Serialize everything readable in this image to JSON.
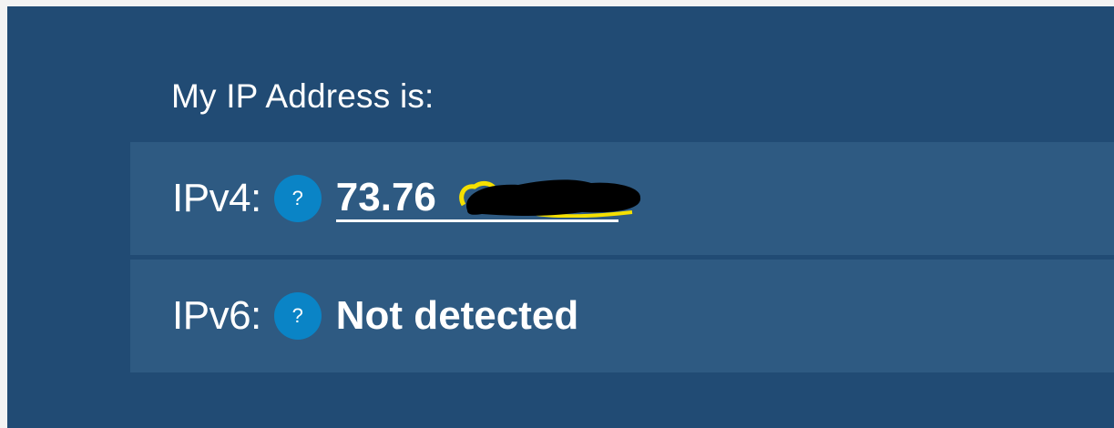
{
  "heading": "My IP Address is:",
  "ipv4": {
    "label": "IPv4:",
    "help_icon_text": "?",
    "value": "73.76",
    "redacted": true
  },
  "ipv6": {
    "label": "IPv6:",
    "help_icon_text": "?",
    "value": "Not detected"
  },
  "colors": {
    "panel_background": "#214b74",
    "row_background": "#2e5a82",
    "help_icon": "#0a84c6",
    "text": "#ffffff",
    "redaction_marker": "#000000",
    "highlight": "#f5e000"
  }
}
